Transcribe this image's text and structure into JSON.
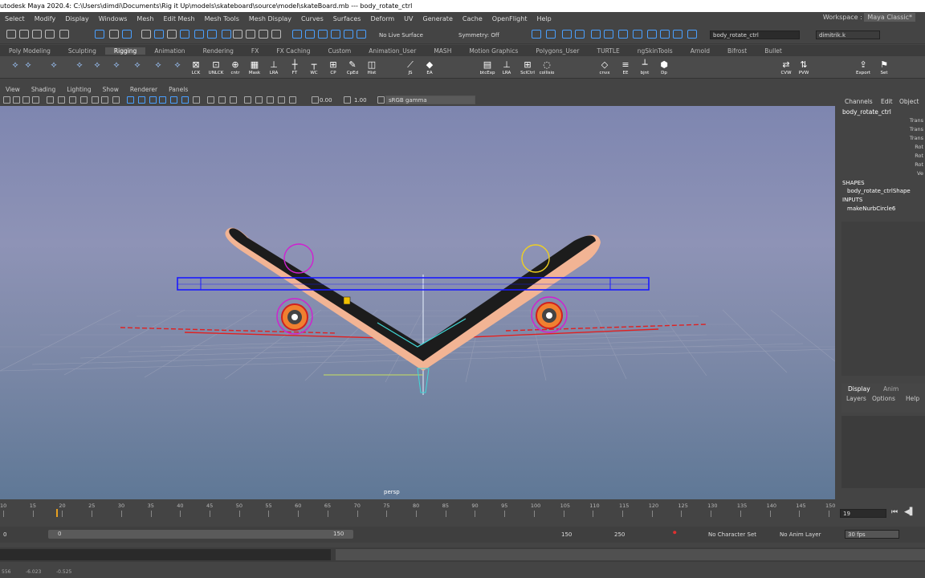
{
  "window": {
    "title": "utodesk Maya 2020.4: C:\\Users\\dimdi\\Documents\\Rig it Up\\models\\skateboard\\source\\model\\skateBoard.mb   ---   body_rotate_ctrl"
  },
  "menubar": {
    "items": [
      "Select",
      "Modify",
      "Display",
      "Windows",
      "Mesh",
      "Edit Mesh",
      "Mesh Tools",
      "Mesh Display",
      "Curves",
      "Surfaces",
      "Deform",
      "UV",
      "Generate",
      "Cache",
      "OpenFlight",
      "Help"
    ],
    "workspace_label": "Workspace :",
    "workspace_value": "Maya Classic*"
  },
  "statusline": {
    "live_surface": "No Live Surface",
    "symmetry": "Symmetry: Off",
    "name_field": "body_rotate_ctrl",
    "user": "dimitrik.k"
  },
  "shelf": {
    "tabs": [
      "Poly Modeling",
      "Sculpting",
      "Rigging",
      "Animation",
      "Rendering",
      "FX",
      "FX Caching",
      "Custom",
      "Animation_User",
      "MASH",
      "Motion Graphics",
      "Polygons_User",
      "TURTLE",
      "ngSkinTools",
      "Arnold",
      "Bifrost",
      "Bullet"
    ],
    "active_tab": "Rigging",
    "buttons": [
      "LCK",
      "UNLCK",
      "cntr",
      "Mask",
      "LRA",
      "FT",
      "WC",
      "CP",
      "CpEd",
      "Hist",
      "JS",
      "EA",
      "btcExp",
      "LRA",
      "SclCtrl",
      "collisio",
      "cnvx",
      "EE",
      "bjnt",
      "Dp",
      "CVW",
      "PVW",
      "Export",
      "Set"
    ]
  },
  "panel": {
    "menu": [
      "View",
      "Shading",
      "Lighting",
      "Show",
      "Renderer",
      "Panels"
    ],
    "exposure": "0.00",
    "gamma": "1.00",
    "colorspace": "sRGB gamma",
    "camera_label": "persp"
  },
  "channelbox": {
    "menu": [
      "Channels",
      "Edit",
      "Object"
    ],
    "node": "body_rotate_ctrl",
    "attrs": [
      "Trans",
      "Trans",
      "Trans",
      "Rot",
      "Rot",
      "Rot",
      "Ve"
    ],
    "shapes_header": "SHAPES",
    "shape": "body_rotate_ctrlShape",
    "inputs_header": "INPUTS",
    "input": "makeNurbCircle6",
    "layer_tabs": [
      "Display",
      "Anim"
    ],
    "layer_menu": [
      "Layers",
      "Options",
      "Help"
    ]
  },
  "timeline": {
    "ticks": [
      "10",
      "15",
      "20",
      "25",
      "30",
      "35",
      "40",
      "45",
      "50",
      "55",
      "60",
      "65",
      "70",
      "75",
      "80",
      "85",
      "90",
      "95",
      "100",
      "105",
      "110",
      "115",
      "120",
      "125",
      "130",
      "135",
      "140",
      "145",
      "150"
    ],
    "current_frame": "19",
    "playhead_frame": 19
  },
  "range": {
    "start": "0",
    "end_inner": "150",
    "end_field": "150",
    "end_outer": "250",
    "character_set": "No Character Set",
    "anim_layer": "No Anim Layer",
    "fps": "30 fps"
  },
  "helpline": {
    "coords": [
      "556",
      "-6.023",
      "-0.525"
    ]
  },
  "colors": {
    "viewport_top": "#7e86b0",
    "selection_blue": "#0000ff",
    "ctrl_magenta": "#d020d0",
    "ctrl_yellow": "#f0d020",
    "grid_red": "#e02020",
    "board_tan": "#f0b088",
    "deck_black": "#1a1a1a"
  }
}
